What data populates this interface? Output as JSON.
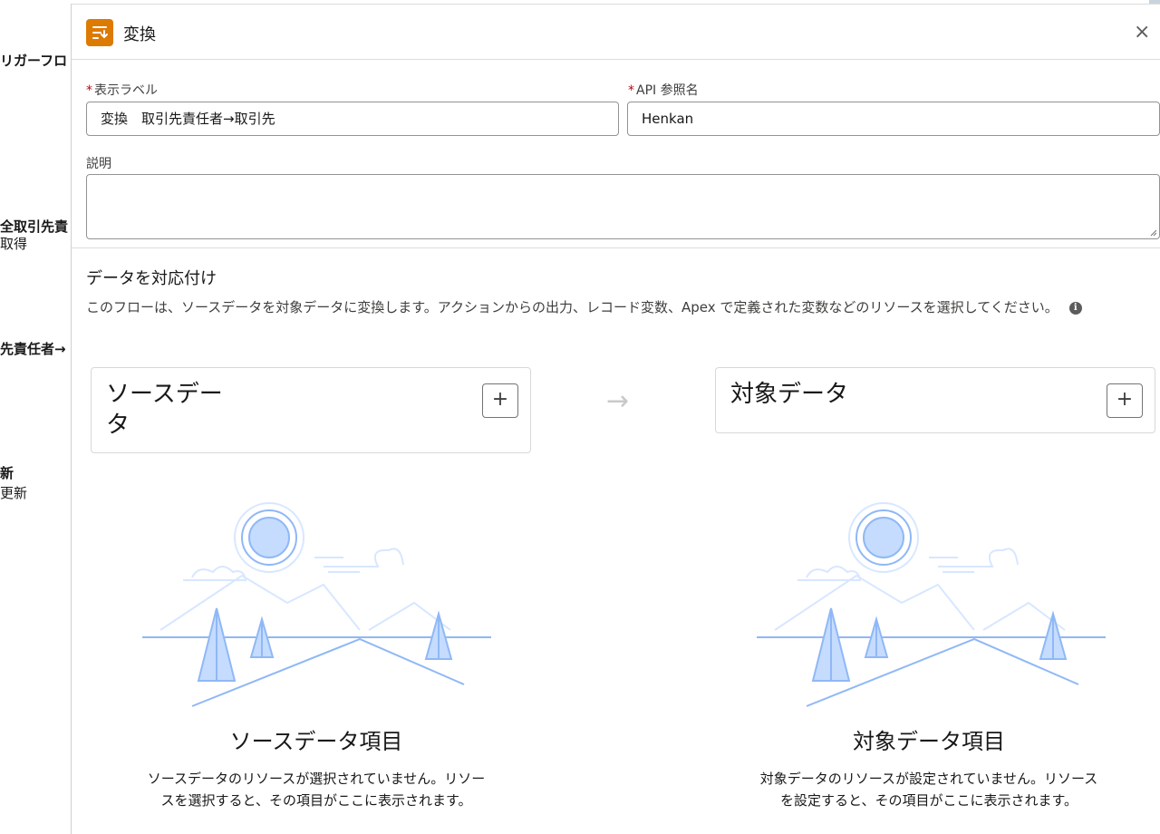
{
  "background_canvas": {
    "fragments": [
      {
        "text": "リガーフロ",
        "bold": true
      },
      {
        "text": "全取引先責",
        "bold": true
      },
      {
        "text": "取得",
        "bold": false
      },
      {
        "text": "先責任者→",
        "bold": true
      },
      {
        "text": "新",
        "bold": true
      },
      {
        "text": "更新",
        "bold": false
      }
    ]
  },
  "panel": {
    "title": "変換",
    "icon": "transform-icon",
    "close_label": "×",
    "display_label": {
      "required_mark": "*",
      "label": "表示ラベル",
      "value": "変換　取引先責任者→取引先"
    },
    "api_name": {
      "required_mark": "*",
      "label": "API 参照名",
      "value": "Henkan"
    },
    "description": {
      "label": "説明",
      "value": ""
    },
    "mapping": {
      "title": "データを対応付け",
      "description": "このフローは、ソースデータを対象データに変換します。アクションからの出力、レコード変数、Apex で定義された変数などのリソースを選択してください。",
      "info_icon": "i"
    },
    "source_card": {
      "title": "ソースデー\nタ",
      "add_label": "+"
    },
    "arrow_label": "→",
    "target_card": {
      "title": "対象データ",
      "add_label": "+"
    },
    "source_empty": {
      "title": "ソースデータ項目",
      "line1": "ソースデータのリソースが選択されていません。リソー",
      "line2": "スを選択すると、その項目がここに表示されます。"
    },
    "target_empty": {
      "title": "対象データ項目",
      "line1": "対象データのリソースが設定されていません。リソース",
      "line2": "を設定すると、その項目がここに表示されます。"
    }
  },
  "colors": {
    "accent_icon": "#dd7a01",
    "illustration_fill": "#c5dcff",
    "illustration_stroke": "#8fb8f6"
  }
}
